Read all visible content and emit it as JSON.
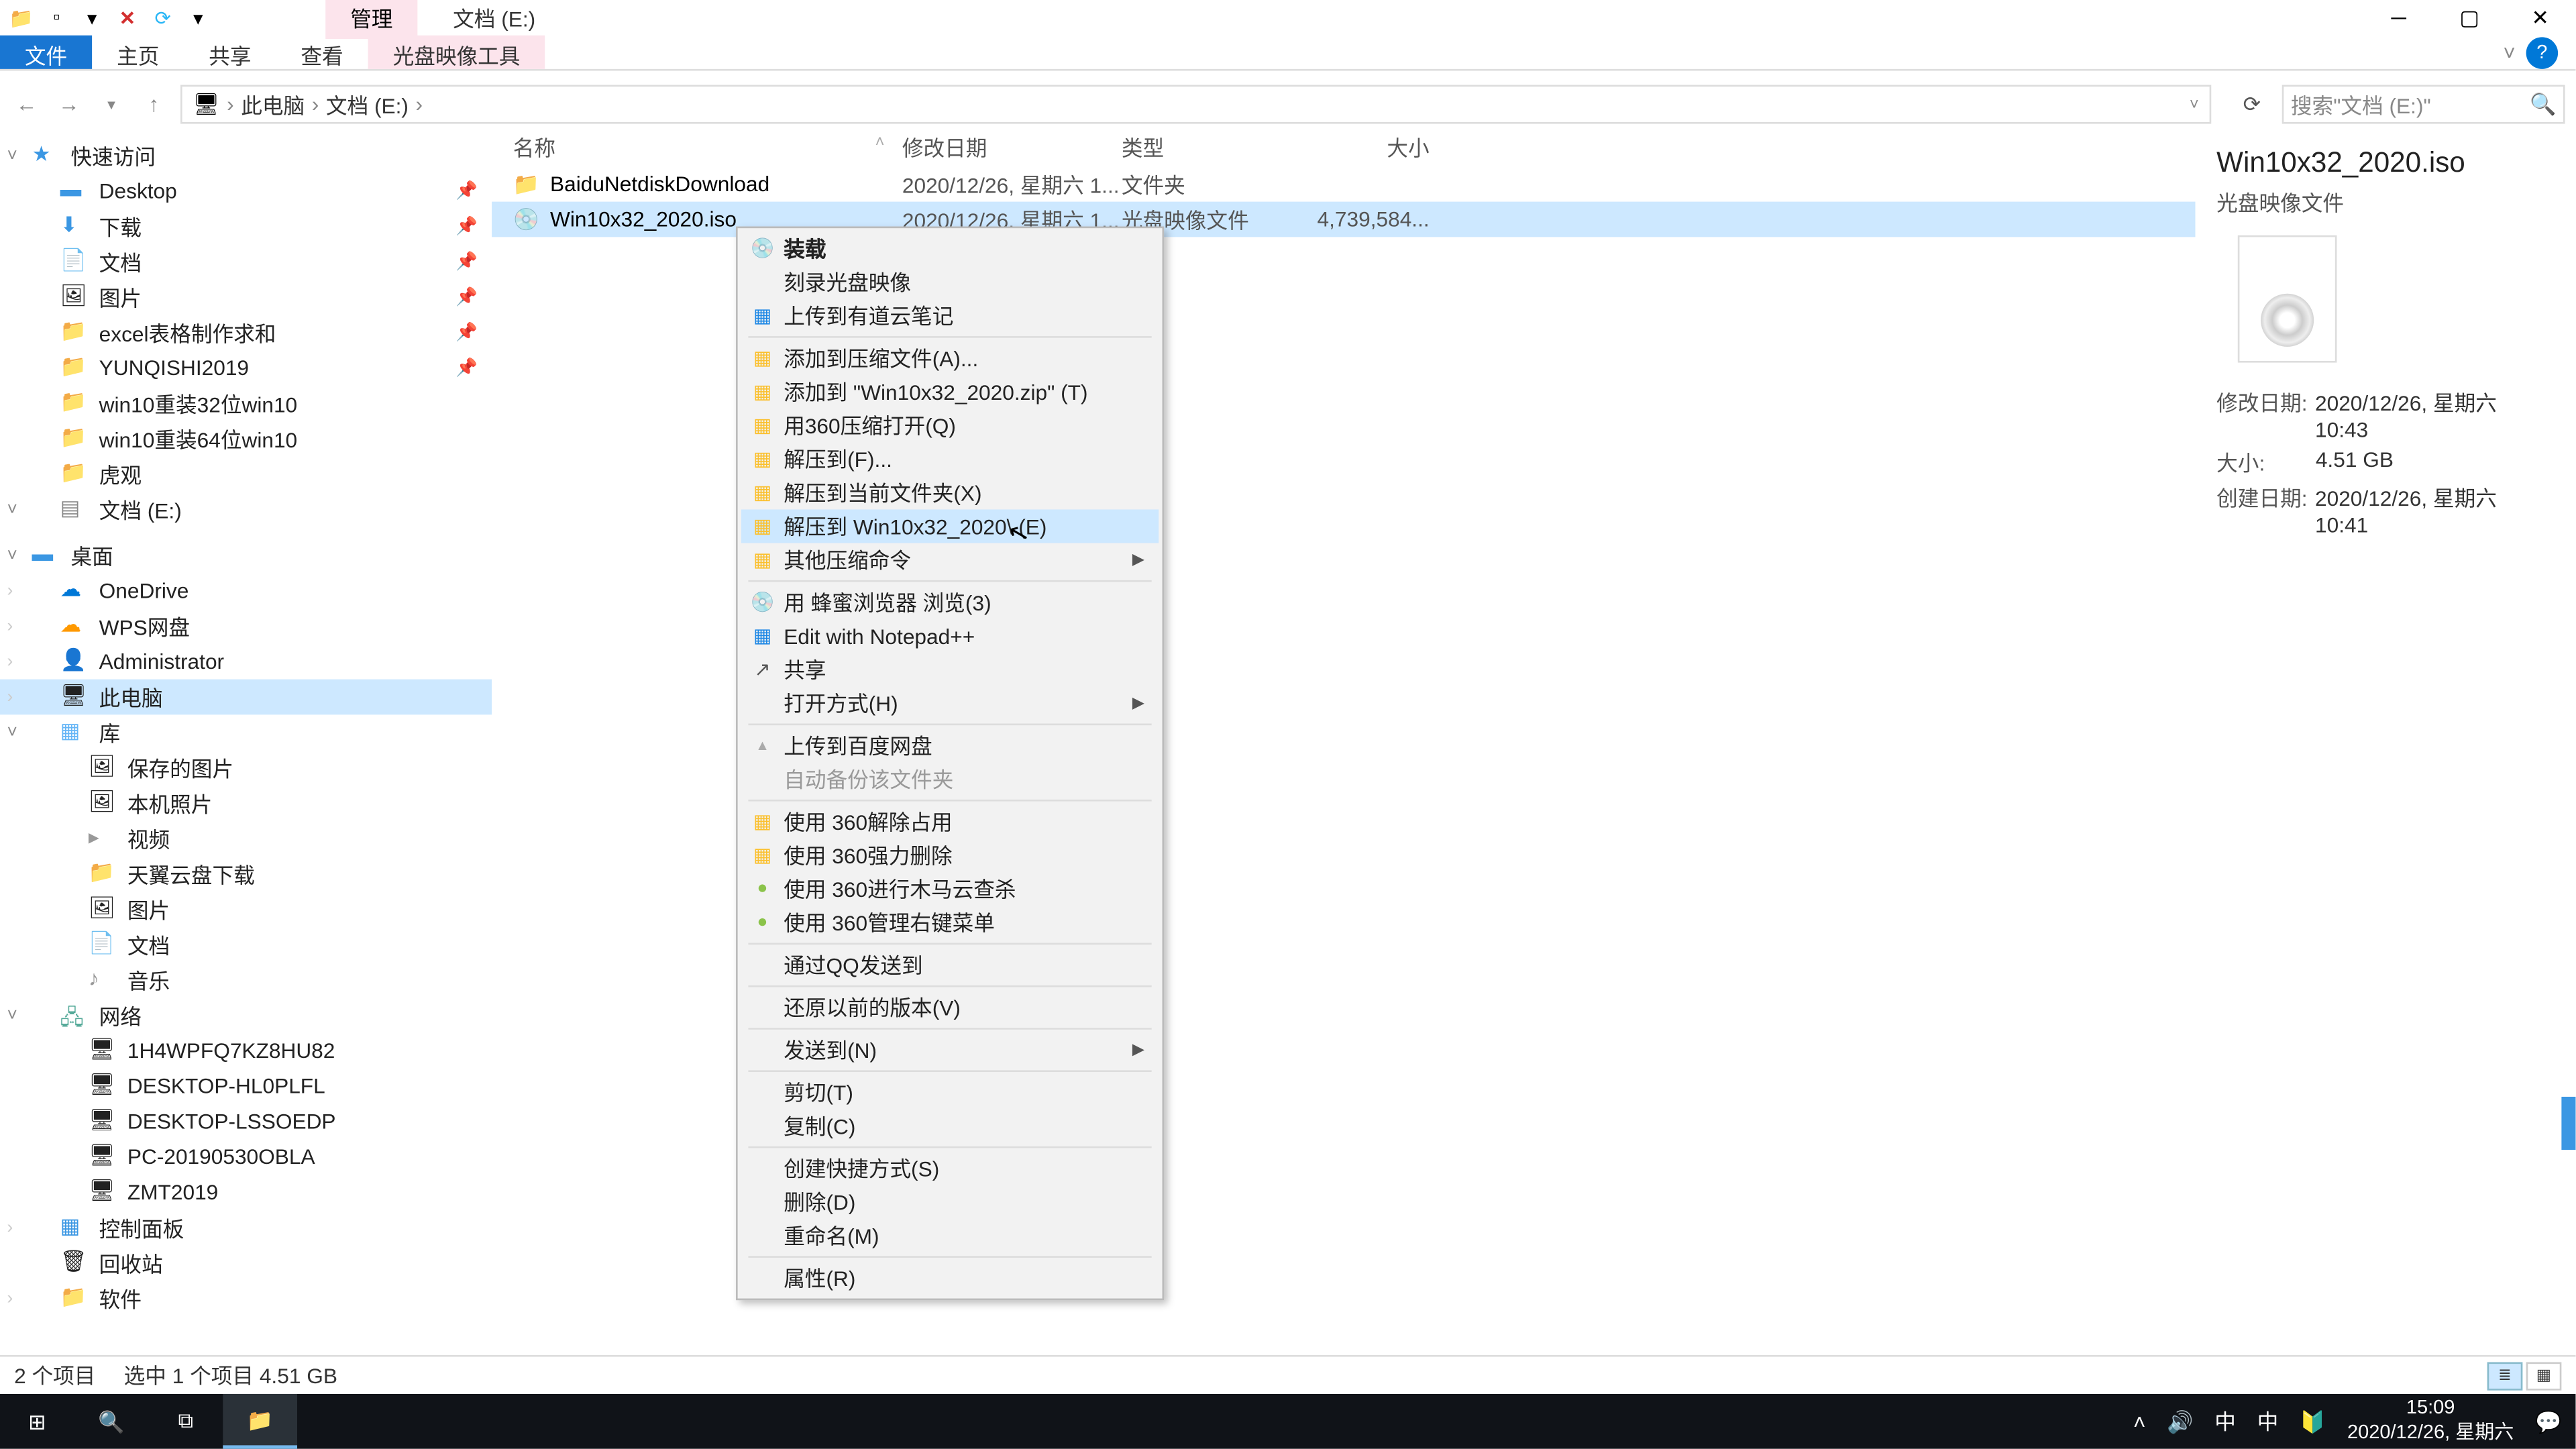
{
  "title_context_tab": "管理",
  "title_drive": "文档 (E:)",
  "ribbon": {
    "file": "文件",
    "home": "主页",
    "share": "共享",
    "view": "查看",
    "context": "光盘映像工具"
  },
  "breadcrumb": {
    "root": "此电脑",
    "drive": "文档 (E:)"
  },
  "search_placeholder": "搜索\"文档 (E:)\"",
  "tree": {
    "quick_access": "快速访问",
    "desktop": "Desktop",
    "downloads": "下载",
    "documents": "文档",
    "pictures": "图片",
    "excel": "excel表格制作求和",
    "yunqishi": "YUNQISHI2019",
    "win32": "win10重装32位win10",
    "win64": "win10重装64位win10",
    "huguan": "虎观",
    "drive_e": "文档 (E:)",
    "desktop_top": "桌面",
    "onedrive": "OneDrive",
    "wps": "WPS网盘",
    "admin": "Administrator",
    "thispc": "此电脑",
    "libraries": "库",
    "saved_pics": "保存的图片",
    "local_photos": "本机照片",
    "videos": "视频",
    "tianyi": "天翼云盘下载",
    "pics_lib": "图片",
    "docs_lib": "文档",
    "music_lib": "音乐",
    "network": "网络",
    "net1": "1H4WPFQ7KZ8HU82",
    "net2": "DESKTOP-HL0PLFL",
    "net3": "DESKTOP-LSSOEDP",
    "net4": "PC-20190530OBLA",
    "net5": "ZMT2019",
    "control_panel": "控制面板",
    "recycle": "回收站",
    "software": "软件"
  },
  "columns": {
    "name": "名称",
    "date": "修改日期",
    "type": "类型",
    "size": "大小"
  },
  "rows": [
    {
      "name": "BaiduNetdiskDownload",
      "date": "2020/12/26, 星期六 1...",
      "type": "文件夹",
      "size": "",
      "icon": "folder",
      "selected": false
    },
    {
      "name": "Win10x32_2020.iso",
      "date": "2020/12/26, 星期六 1...",
      "type": "光盘映像文件",
      "size": "4,739,584...",
      "icon": "iso",
      "selected": true
    }
  ],
  "context_menu": [
    {
      "label": "装载",
      "icon": "disc",
      "bold": true
    },
    {
      "label": "刻录光盘映像"
    },
    {
      "label": "上传到有道云笔记",
      "icon": "note"
    },
    {
      "sep": true
    },
    {
      "label": "添加到压缩文件(A)...",
      "icon": "zip"
    },
    {
      "label": "添加到 \"Win10x32_2020.zip\" (T)",
      "icon": "zip"
    },
    {
      "label": "用360压缩打开(Q)",
      "icon": "zip"
    },
    {
      "label": "解压到(F)...",
      "icon": "zip"
    },
    {
      "label": "解压到当前文件夹(X)",
      "icon": "zip"
    },
    {
      "label": "解压到 Win10x32_2020\\ (E)",
      "icon": "zip",
      "hover": true
    },
    {
      "label": "其他压缩命令",
      "icon": "zip",
      "submenu": true
    },
    {
      "sep": true
    },
    {
      "label": "用 蜂蜜浏览器 浏览(3)",
      "icon": "disc"
    },
    {
      "label": "Edit with Notepad++",
      "icon": "note"
    },
    {
      "label": "共享",
      "icon": "share"
    },
    {
      "label": "打开方式(H)",
      "submenu": true
    },
    {
      "sep": true
    },
    {
      "label": "上传到百度网盘",
      "icon": "up"
    },
    {
      "label": "自动备份该文件夹",
      "disabled": true
    },
    {
      "sep": true
    },
    {
      "label": "使用 360解除占用",
      "icon": "b360"
    },
    {
      "label": "使用 360强力删除",
      "icon": "b360"
    },
    {
      "label": "使用 360进行木马云查杀",
      "icon": "g360"
    },
    {
      "label": "使用 360管理右键菜单",
      "icon": "g360"
    },
    {
      "sep": true
    },
    {
      "label": "通过QQ发送到"
    },
    {
      "sep": true
    },
    {
      "label": "还原以前的版本(V)"
    },
    {
      "sep": true
    },
    {
      "label": "发送到(N)",
      "submenu": true
    },
    {
      "sep": true
    },
    {
      "label": "剪切(T)"
    },
    {
      "label": "复制(C)"
    },
    {
      "sep": true
    },
    {
      "label": "创建快捷方式(S)"
    },
    {
      "label": "删除(D)"
    },
    {
      "label": "重命名(M)"
    },
    {
      "sep": true
    },
    {
      "label": "属性(R)"
    }
  ],
  "details": {
    "title": "Win10x32_2020.iso",
    "type": "光盘映像文件",
    "labels": {
      "mod": "修改日期:",
      "size": "大小:",
      "created": "创建日期:"
    },
    "mod": "2020/12/26, 星期六 10:43",
    "size": "4.51 GB",
    "created": "2020/12/26, 星期六 10:41"
  },
  "statusbar": {
    "items": "2 个项目",
    "selected": "选中 1 个项目  4.51 GB"
  },
  "tray": {
    "ime1": "中",
    "ime2": "中",
    "time": "15:09",
    "date": "2020/12/26, 星期六"
  }
}
